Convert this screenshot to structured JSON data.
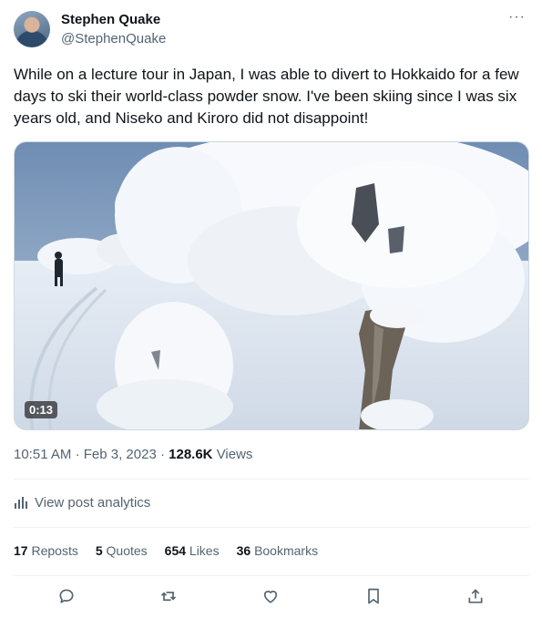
{
  "author": {
    "name": "Stephen Quake",
    "handle": "@StephenQuake"
  },
  "more_menu": "···",
  "post": {
    "text": "While on a lecture tour in Japan, I was able to divert to Hokkaido for a few days to ski their world-class powder snow. I've been skiing since I was six years old, and Niseko and Kiroro did not disappoint!",
    "video_duration": "0:13",
    "time": "10:51 AM",
    "date": "Feb 3, 2023",
    "views_count": "128.6K",
    "views_label": "Views",
    "separator": "·"
  },
  "analytics": {
    "label": "View post analytics"
  },
  "stats": {
    "reposts": {
      "count": "17",
      "label": "Reposts"
    },
    "quotes": {
      "count": "5",
      "label": "Quotes"
    },
    "likes": {
      "count": "654",
      "label": "Likes"
    },
    "bookmarks": {
      "count": "36",
      "label": "Bookmarks"
    }
  },
  "actions": [
    "reply-icon",
    "repost-icon",
    "like-icon",
    "bookmark-icon",
    "share-icon"
  ],
  "colors": {
    "text": "#0f1419",
    "secondary": "#536471",
    "divider": "#eff3f4"
  }
}
